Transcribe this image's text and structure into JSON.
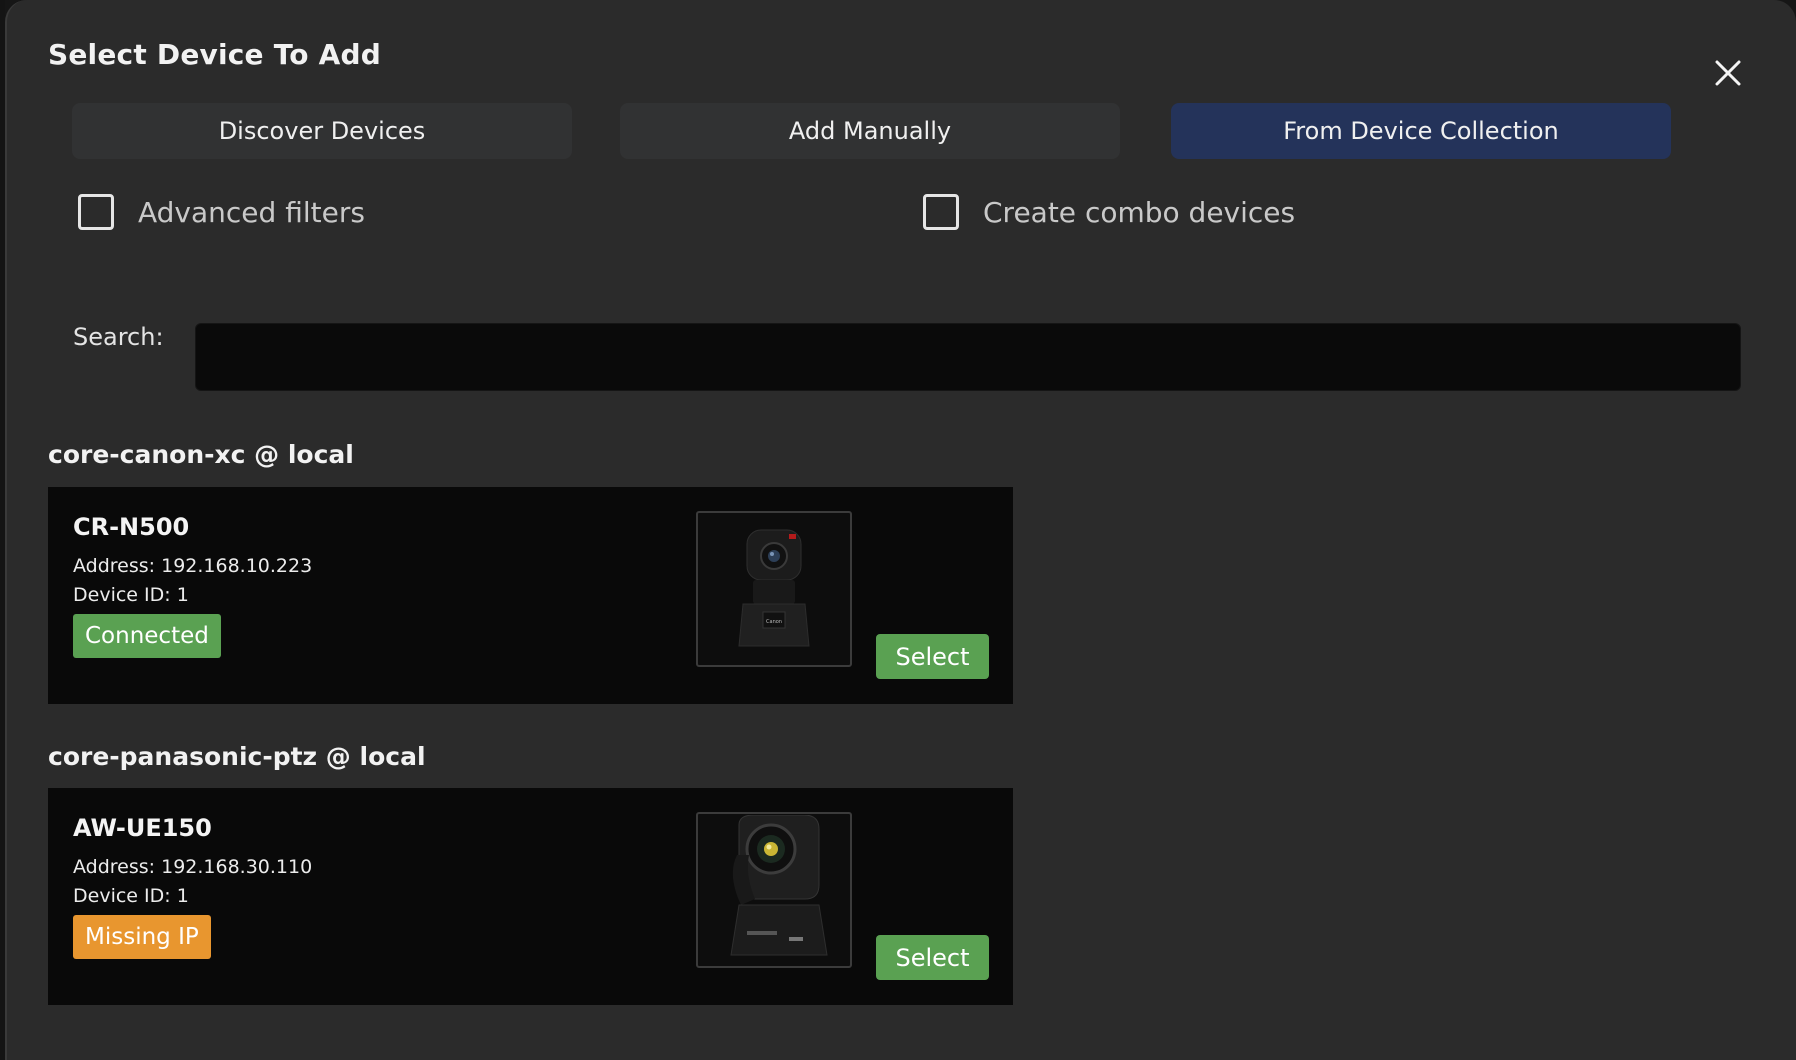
{
  "dialog": {
    "title": "Select Device To Add"
  },
  "tabs": [
    {
      "label": "Discover Devices",
      "active": false
    },
    {
      "label": "Add Manually",
      "active": false
    },
    {
      "label": "From Device Collection",
      "active": true
    }
  ],
  "filters": {
    "advanced_label": "Advanced filters",
    "advanced_checked": false,
    "combo_label": "Create combo devices",
    "combo_checked": false
  },
  "search": {
    "label": "Search:",
    "value": ""
  },
  "groups": [
    {
      "title": "core-canon-xc @ local",
      "devices": [
        {
          "name": "CR-N500",
          "address": "Address: 192.168.10.223",
          "device_id": "Device ID: 1",
          "status": "Connected",
          "status_color": "#5aa152",
          "thumbnail_icon": "ptz-camera-canon-icon",
          "select_label": "Select"
        }
      ]
    },
    {
      "title": "core-panasonic-ptz @ local",
      "devices": [
        {
          "name": "AW-UE150",
          "address": "Address: 192.168.30.110",
          "device_id": "Device ID: 1",
          "status": "Missing IP",
          "status_color": "#e8962f",
          "thumbnail_icon": "ptz-camera-panasonic-icon",
          "select_label": "Select"
        }
      ]
    }
  ],
  "colors": {
    "dialog_bg": "#2b2b2b",
    "tab_bg": "#313233",
    "tab_active_bg": "#24335a",
    "card_bg": "#090909",
    "success": "#5aa152",
    "warning": "#e8962f"
  }
}
